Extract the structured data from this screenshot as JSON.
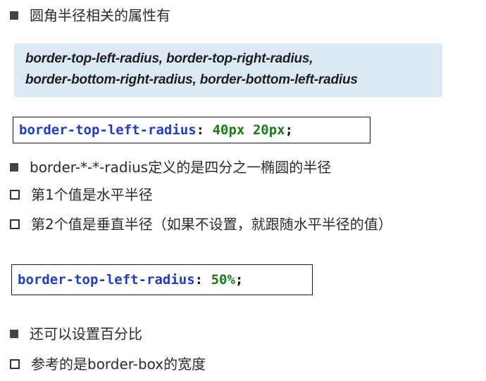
{
  "section1": {
    "heading": "圆角半径相关的属性有",
    "props_line1": "border-top-left-radius, border-top-right-radius,",
    "props_line2": "border-bottom-right-radius, border-bottom-left-radius"
  },
  "code1": {
    "property": "border-top-left-radius",
    "colon": ":",
    "value1_num": "40",
    "value1_unit": "px",
    "value2_num": "20",
    "value2_unit": "px",
    "semicolon": ";"
  },
  "section2": {
    "bullet_main": "border-*-*-radius定义的是四分之一椭圆的半径",
    "sub1": "第1个值是水平半径",
    "sub2": "第2个值是垂直半径（如果不设置，就跟随水平半径的值）"
  },
  "code2": {
    "property": "border-top-left-radius",
    "colon": ":",
    "value_num": "50",
    "value_unit": "%",
    "semicolon": ";"
  },
  "section3": {
    "bullet_main": "还可以设置百分比",
    "sub1": "参考的是border-box的宽度"
  }
}
